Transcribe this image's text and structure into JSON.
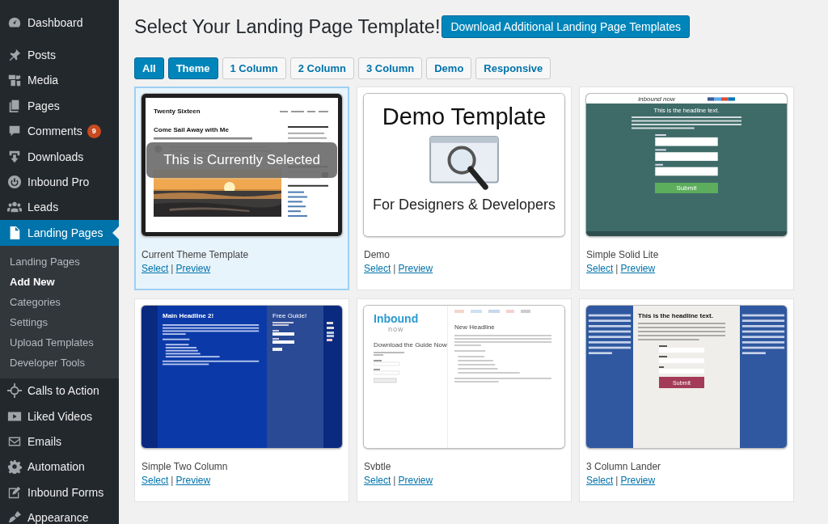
{
  "sidebar": {
    "menu_groups": [
      [
        {
          "label": "Dashboard",
          "selected": false
        }
      ],
      [
        {
          "label": "Posts",
          "selected": false
        },
        {
          "label": "Media",
          "selected": false
        },
        {
          "label": "Pages",
          "selected": false
        },
        {
          "label": "Comments",
          "selected": false,
          "badge": "9"
        },
        {
          "label": "Downloads",
          "selected": false
        },
        {
          "label": "Inbound Pro",
          "selected": false
        },
        {
          "label": "Leads",
          "selected": false
        },
        {
          "label": "Landing Pages",
          "selected": true,
          "submenu": [
            {
              "label": "Landing Pages",
              "selected": false
            },
            {
              "label": "Add New",
              "selected": true
            },
            {
              "label": "Categories",
              "selected": false
            },
            {
              "label": "Settings",
              "selected": false
            },
            {
              "label": "Upload Templates",
              "selected": false
            },
            {
              "label": "Developer Tools",
              "selected": false
            }
          ]
        },
        {
          "label": "Calls to Action",
          "selected": false
        },
        {
          "label": "Liked Videos",
          "selected": false
        },
        {
          "label": "Emails",
          "selected": false
        },
        {
          "label": "Automation",
          "selected": false
        },
        {
          "label": "Inbound Forms",
          "selected": false
        },
        {
          "label": "Appearance",
          "selected": false
        }
      ]
    ]
  },
  "page": {
    "title": "Select Your Landing Page Template!",
    "download_button": "Download Additional Landing Page Templates"
  },
  "filters": [
    {
      "label": "All",
      "selected": true
    },
    {
      "label": "Theme",
      "selected": true
    },
    {
      "label": "1 Column",
      "selected": false
    },
    {
      "label": "2 Column",
      "selected": false
    },
    {
      "label": "3 Column",
      "selected": false
    },
    {
      "label": "Demo",
      "selected": false
    },
    {
      "label": "Responsive",
      "selected": false
    }
  ],
  "templates": [
    {
      "title": "Current Theme Template",
      "selected": true,
      "links": [
        "Select",
        "Preview"
      ],
      "separator": "|",
      "thumbnail": {
        "kind": "theme",
        "site_title": "Twenty Sixteen",
        "post_title": "Come Sail Away with Me",
        "overlay": "This is Currently Selected"
      }
    },
    {
      "title": "Demo",
      "selected": false,
      "links": [
        "Select",
        "Preview"
      ],
      "separator": "|",
      "thumbnail": {
        "kind": "demo",
        "heading": "Demo Template",
        "subheading": "For Designers & Developers"
      }
    },
    {
      "title": "Simple Solid Lite",
      "selected": false,
      "links": [
        "Select",
        "Preview"
      ],
      "separator": "|",
      "thumbnail": {
        "kind": "solid",
        "logo": "inbound now",
        "headline": "This is the headline text.",
        "button": "Submit"
      }
    },
    {
      "title": "Simple Two Column",
      "selected": false,
      "links": [
        "Select",
        "Preview"
      ],
      "separator": "|",
      "thumbnail": {
        "kind": "two-column",
        "headline": "Main Headline 2!",
        "side_title": "Free Guide!"
      }
    },
    {
      "title": "Svbtle",
      "selected": false,
      "links": [
        "Select",
        "Preview"
      ],
      "separator": "|",
      "thumbnail": {
        "kind": "svbtle",
        "logo": "Inbound",
        "logo_sub": "now",
        "side_title": "Download the Guide Now",
        "headline": "New Headline"
      }
    },
    {
      "title": "3 Column Lander",
      "selected": false,
      "links": [
        "Select",
        "Preview"
      ],
      "separator": "|",
      "thumbnail": {
        "kind": "three-column",
        "headline": "This is the headline text.",
        "button": "Submit"
      }
    }
  ]
}
